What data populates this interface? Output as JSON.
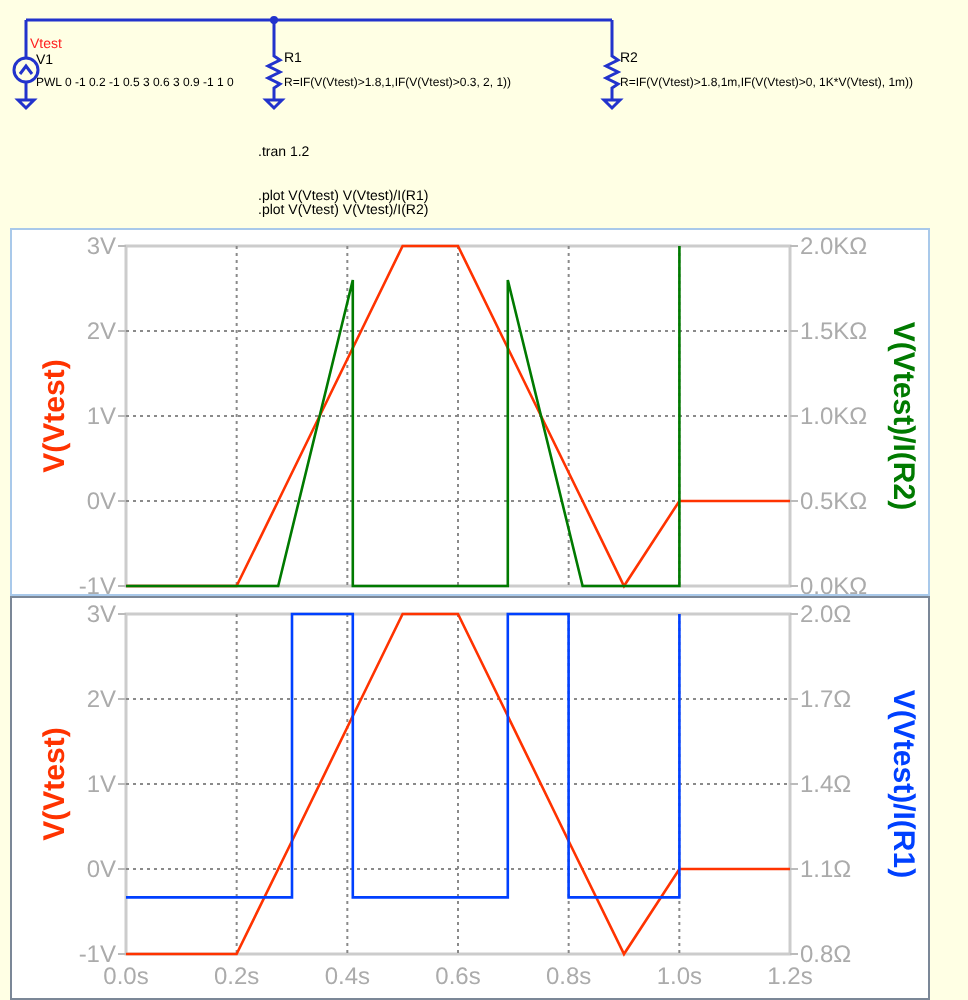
{
  "schematic": {
    "source": {
      "net_label": "Vtest",
      "name": "V1",
      "value": "PWL 0 -1 0.2 -1 0.5 3 0.6 3 0.9 -1 1 0"
    },
    "resistors": [
      {
        "name": "R1",
        "value": "R=IF(V(Vtest)>1.8,1,IF(V(Vtest)>0.3, 2, 1))"
      },
      {
        "name": "R2",
        "value": "R=IF(V(Vtest)>1.8,1m,IF(V(Vtest)>0, 1K*V(Vtest), 1m))"
      }
    ],
    "directives": [
      ".tran 1.2",
      ".plot V(Vtest) V(Vtest)/I(R1)",
      ".plot V(Vtest) V(Vtest)/I(R2)"
    ]
  },
  "plots": [
    {
      "chart_data": {
        "type": "line",
        "grid": true,
        "xlim": [
          0,
          1.2
        ],
        "ylim": [
          -1,
          3
        ],
        "y2lim": [
          0,
          2
        ],
        "yticks": [
          {
            "value": 3,
            "label": "3V"
          },
          {
            "value": 2,
            "label": "2V"
          },
          {
            "value": 1,
            "label": "1V"
          },
          {
            "value": 0,
            "label": "0V"
          },
          {
            "value": -1,
            "label": "-1V"
          }
        ],
        "y2ticks": [
          {
            "value": 2,
            "label": "2.0KΩ"
          },
          {
            "value": 1.5,
            "label": "1.5KΩ"
          },
          {
            "value": 1,
            "label": "1.0KΩ"
          },
          {
            "value": 0.5,
            "label": "0.5KΩ"
          },
          {
            "value": 0,
            "label": "0.0KΩ"
          }
        ],
        "x": [
          0,
          0.2,
          0.275,
          0.41,
          0.41,
          0.5,
          0.6,
          0.69,
          0.69,
          0.825,
          0.9,
          1.0,
          1.0,
          1.2
        ],
        "series": [
          {
            "name": "V(Vtest)",
            "color": "#ff3300",
            "axis": "y",
            "values": [
              -1,
              -1,
              0,
              1.8,
              1.8,
              3,
              3,
              1.8,
              1.8,
              0,
              -1,
              0,
              0,
              0
            ]
          },
          {
            "name": "V(Vtest)/I(R2)",
            "color": "#007a00",
            "axis": "y2",
            "values": [
              0,
              0,
              0,
              1.8,
              0,
              0,
              0,
              0,
              1.8,
              0,
              0,
              0,
              2.0,
              null
            ]
          }
        ]
      }
    },
    {
      "chart_data": {
        "type": "line",
        "grid": true,
        "xlim": [
          0,
          1.2
        ],
        "ylim": [
          -1,
          3
        ],
        "y2lim": [
          0.8,
          2.0
        ],
        "xticks": [
          {
            "value": 0,
            "label": "0.0s"
          },
          {
            "value": 0.2,
            "label": "0.2s"
          },
          {
            "value": 0.4,
            "label": "0.4s"
          },
          {
            "value": 0.6,
            "label": "0.6s"
          },
          {
            "value": 0.8,
            "label": "0.8s"
          },
          {
            "value": 1.0,
            "label": "1.0s"
          },
          {
            "value": 1.2,
            "label": "1.2s"
          }
        ],
        "yticks": [
          {
            "value": 3,
            "label": "3V"
          },
          {
            "value": 2,
            "label": "2V"
          },
          {
            "value": 1,
            "label": "1V"
          },
          {
            "value": 0,
            "label": "0V"
          },
          {
            "value": -1,
            "label": "-1V"
          }
        ],
        "y2ticks": [
          {
            "value": 2.0,
            "label": "2.0Ω"
          },
          {
            "value": 1.7,
            "label": "1.7Ω"
          },
          {
            "value": 1.4,
            "label": "1.4Ω"
          },
          {
            "value": 1.1,
            "label": "1.1Ω"
          },
          {
            "value": 0.8,
            "label": "0.8Ω"
          }
        ],
        "x": [
          0,
          0.2,
          0.3,
          0.3,
          0.41,
          0.41,
          0.5,
          0.6,
          0.69,
          0.69,
          0.8,
          0.8,
          0.9,
          1.0,
          1.0,
          1.2
        ],
        "series": [
          {
            "name": "V(Vtest)",
            "color": "#ff3300",
            "axis": "y",
            "values": [
              -1,
              -1,
              0.33,
              0.33,
              1.8,
              1.8,
              3,
              3,
              1.8,
              1.8,
              0.33,
              0.33,
              -1,
              0,
              0,
              0
            ]
          },
          {
            "name": "V(Vtest)/I(R1)",
            "color": "#0040ff",
            "axis": "y2",
            "values": [
              1,
              1,
              1,
              2,
              2,
              1,
              1,
              1,
              1,
              2,
              2,
              1,
              1,
              1,
              2,
              null
            ]
          }
        ]
      }
    }
  ]
}
